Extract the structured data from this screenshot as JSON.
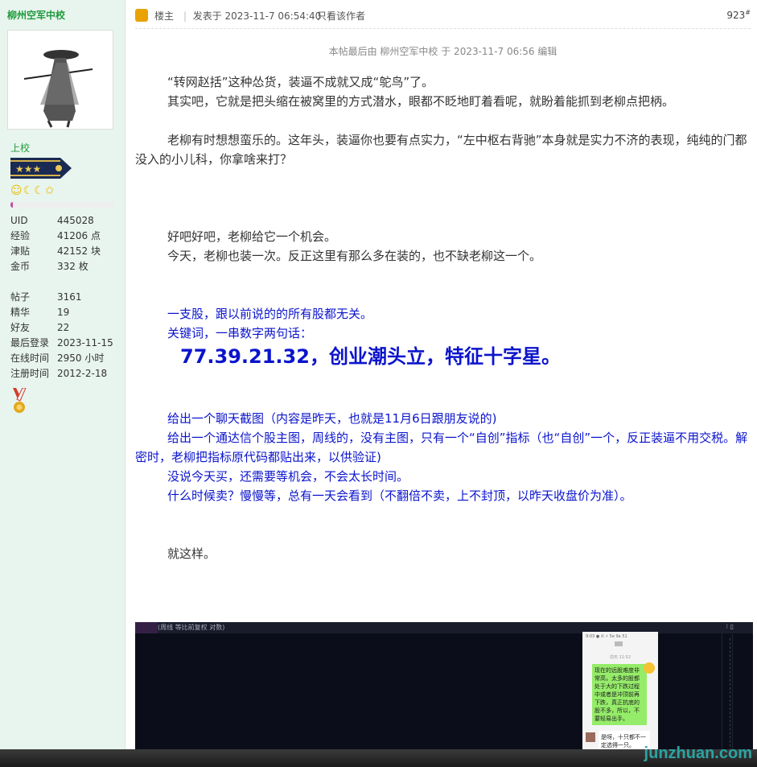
{
  "sidebar": {
    "author_name": "柳州空军中校",
    "rank": "上校",
    "progress_fraction": 0.02,
    "stats": [
      {
        "k": "UID",
        "v": "445028"
      },
      {
        "k": "经验",
        "v": "41206 点"
      },
      {
        "k": "津贴",
        "v": "42152 块"
      },
      {
        "k": "金币",
        "v": "332 枚"
      }
    ],
    "stats2": [
      {
        "k": "帖子",
        "v": "3161"
      },
      {
        "k": "精华",
        "v": "19"
      },
      {
        "k": "好友",
        "v": "22"
      },
      {
        "k": "最后登录",
        "v": "2023-11-15"
      },
      {
        "k": "在线时间",
        "v": "2950 小时"
      },
      {
        "k": "注册时间",
        "v": "2012-2-18"
      }
    ],
    "smilies": "☺☾☾✩"
  },
  "header": {
    "op_label": "楼主",
    "posted_at": "发表于 2023-11-7 06:54:40",
    "only_author": "只看该作者",
    "floor": "923",
    "floor_mark": "#"
  },
  "edited_note": "本帖最后由 柳州空军中校 于 2023-11-7 06:56 编辑",
  "post": {
    "p1": "“转网赵括”这种怂货，装逼不成就又成“鸵鸟”了。",
    "p2": "其实吧，它就是把头缩在被窝里的方式潜水，眼都不眨地盯着看呢，就盼着能抓到老柳点把柄。",
    "p3": "老柳有时想想蛮乐的。这年头，装逼你也要有点实力，“左中枢右背驰”本身就是实力不济的表现，纯纯的门都没入的小儿科，你拿啥来打？",
    "p4": "好吧好吧，老柳给它一个机会。",
    "p5": "今天，老柳也装一次。反正这里有那么多在装的，也不缺老柳这一个。",
    "b1": "一支股，跟以前说的的所有股都无关。",
    "b2": "关键词，一串数字两句话：",
    "big": "77.39.21.32，创业潮头立，特征十字星。",
    "b3": "给出一个聊天截图（内容是昨天，也就是11月6日跟朋友说的)",
    "b4": "给出一个通达信个股主图，周线的，没有主图，只有一个“自创”指标（也“自创”一个，反正装逼不用交税。解密时，老柳把指标原代码都贴出来，以供验证)",
    "b5": "没说今天买，还需要等机会，不会太长时间。",
    "b6": "什么时候卖？慢慢等，总有一天会看到（不翻倍不卖，上不封顶，以昨天收盘价为准）。",
    "p6": "就这样。"
  },
  "screenshot": {
    "title": "(周线 等比前复权 对数)",
    "right_icons": "⁝ ▯",
    "phone_status": "9:03 ● ✆ ⚡ 5e 9a 51",
    "phone_time": "前天 11:52",
    "bubble1": "现在的远股难度非常高，太多的股都处于大的下跌过程中或者是冲顶前再下跌，真正抗底的股不多，所以，不要轻易出手。",
    "bubble2": "是呀，十只都不一定选得一只。"
  },
  "watermark": "junzhuan.com"
}
